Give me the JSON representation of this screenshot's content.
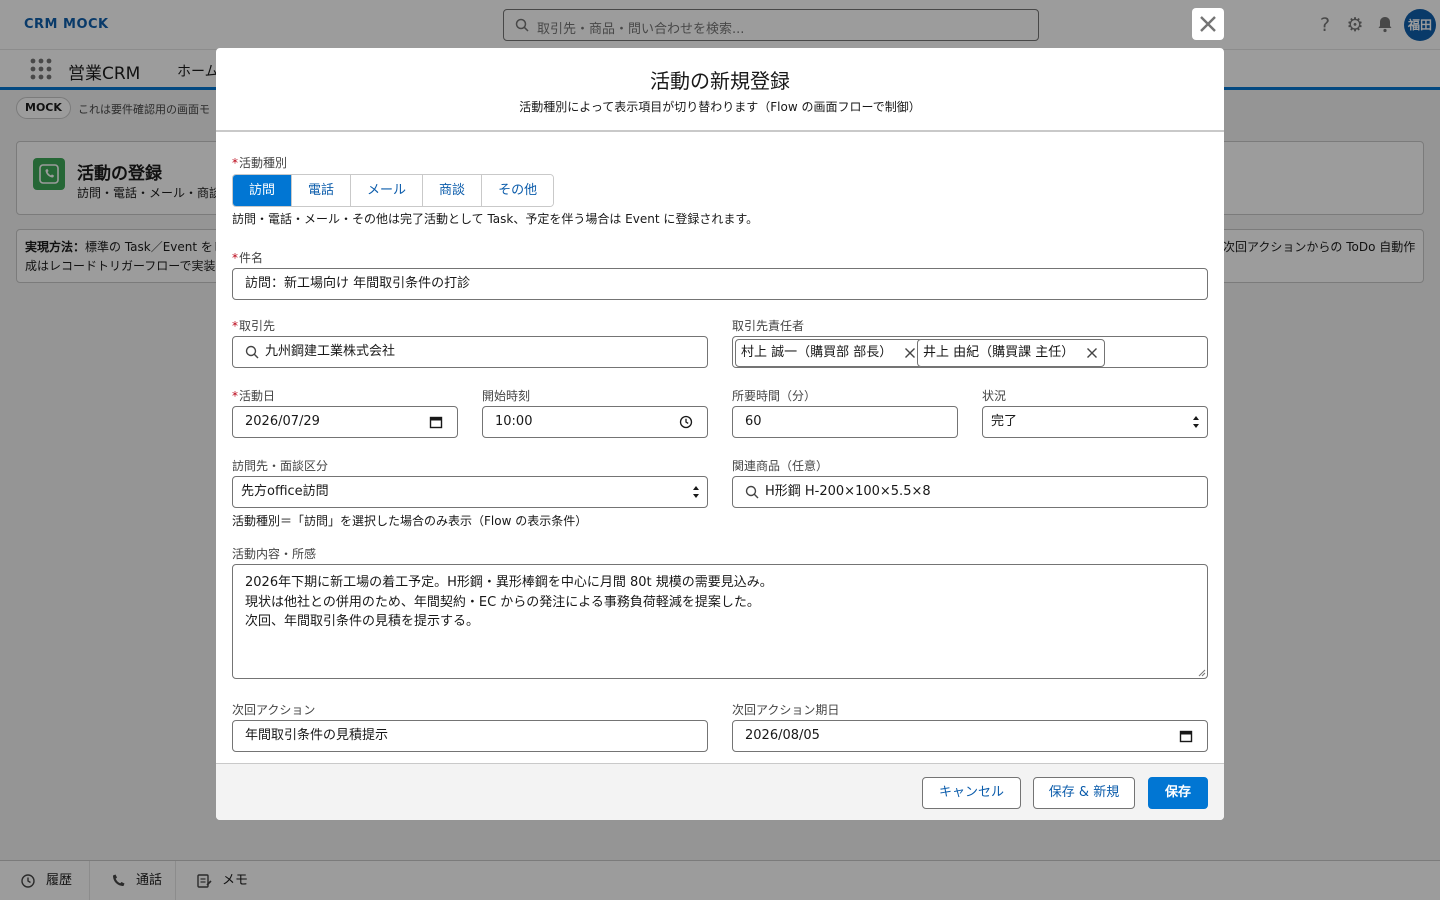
{
  "app": {
    "logo": "CRM MOCK",
    "search_placeholder": "取引先・商品・問い合わせを検索...",
    "avatar_initials": "福田",
    "app_name": "営業CRM",
    "nav_home": "ホーム"
  },
  "mock": {
    "badge": "MOCK",
    "text": "これは要件確認用の画面モ"
  },
  "page_header": {
    "title": "活動の登録",
    "subtitle": "訪問・電話・メール・商談"
  },
  "notice": {
    "label": "実現方法：",
    "line1": "標準の Task／Event をレ",
    "line1_right": "次回アクションからの ToDo 自動作",
    "line2": "成はレコードトリガーフローで実装"
  },
  "utility_bar": {
    "history": "履歴",
    "call": "通話",
    "memo": "メモ"
  },
  "modal": {
    "title": "活動の新規登録",
    "subtitle": "活動種別によって表示項目が切り替わります（Flow の画面フローで制御）",
    "activity_type": {
      "label": "活動種別",
      "options": [
        "訪問",
        "電話",
        "メール",
        "商談",
        "その他"
      ],
      "selected": "訪問",
      "help": "訪問・電話・メール・その他は完了活動として Task、予定を伴う場合は Event に登録されます。"
    },
    "subject": {
      "label": "件名",
      "value": "訪問：新工場向け 年間取引条件の打診"
    },
    "account": {
      "label": "取引先",
      "value": "九州鋼建工業株式会社"
    },
    "contacts": {
      "label": "取引先責任者",
      "pills": [
        "村上 誠一（購買部 部長）",
        "井上 由紀（購買課 主任）"
      ]
    },
    "activity_date": {
      "label": "活動日",
      "value": "2026/07/29"
    },
    "start_time": {
      "label": "開始時刻",
      "value": "10:00"
    },
    "duration": {
      "label": "所要時間（分）",
      "value": "60"
    },
    "status": {
      "label": "状況",
      "value": "完了"
    },
    "visit_type": {
      "label": "訪問先・面談区分",
      "value": "先方office訪問",
      "help": "活動種別＝「訪問」を選択した場合のみ表示（Flow の表示条件）"
    },
    "product": {
      "label": "関連商品（任意）",
      "value": "H形鋼 H-200×100×5.5×8"
    },
    "notes": {
      "label": "活動内容・所感",
      "lines": [
        "2026年下期に新工場の着工予定。H形鋼・異形棒鋼を中心に月間 80t 規模の需要見込み。",
        "現状は他社との併用のため、年間契約・EC からの発注による事務負荷軽減を提案した。",
        "次回、年間取引条件の見積を提示する。"
      ]
    },
    "next_action": {
      "label": "次回アクション",
      "value": "年間取引条件の見積提示"
    },
    "next_action_date": {
      "label": "次回アクション期日",
      "value": "2026/08/05"
    },
    "buttons": {
      "cancel": "キャンセル",
      "save_new": "保存 & 新規",
      "save": "保存"
    }
  }
}
